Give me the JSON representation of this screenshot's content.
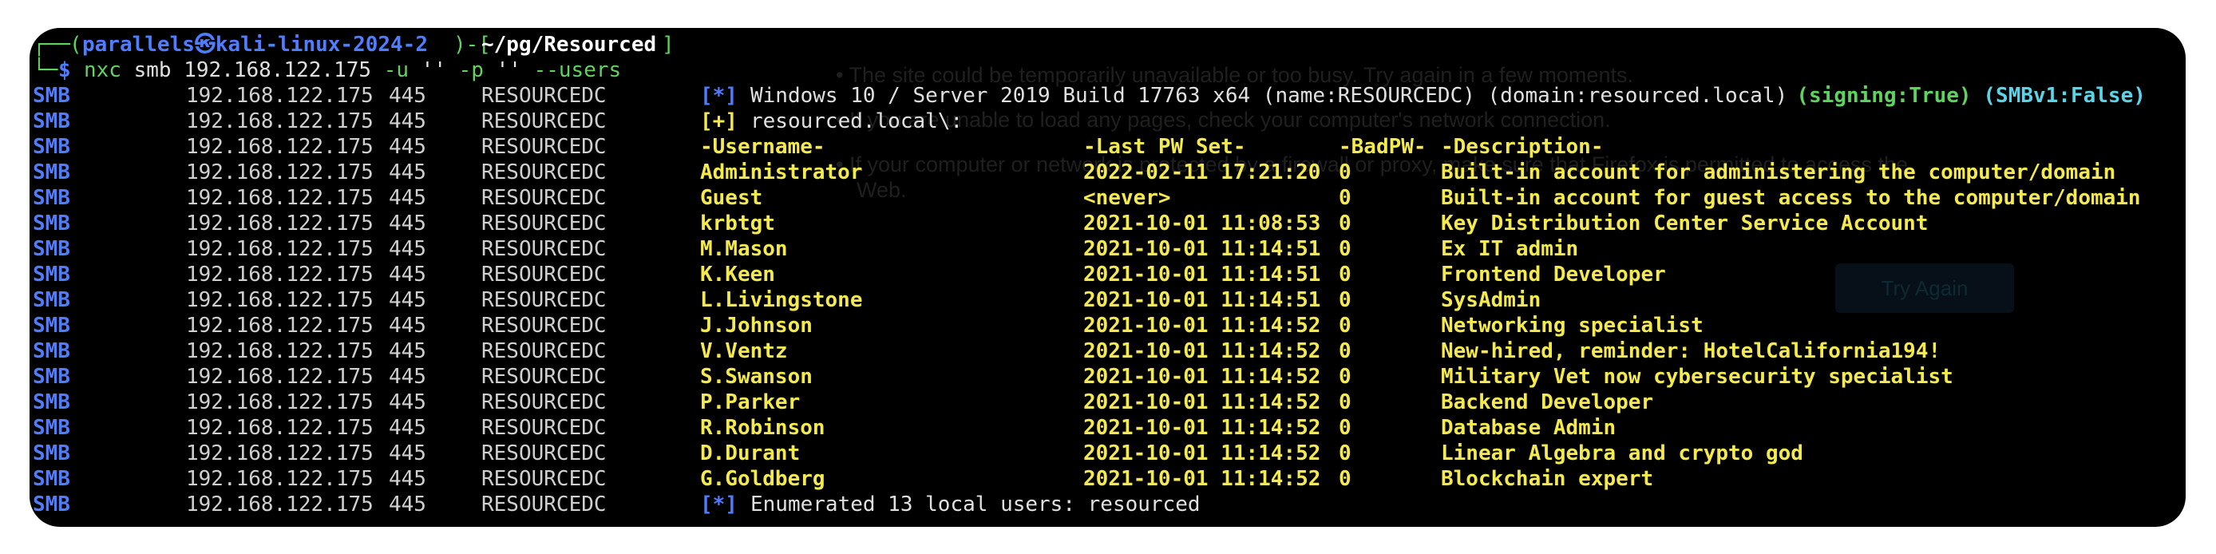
{
  "background_page": {
    "lines": [
      "The site could be temporarily unavailable or too busy. Try again in a few moments.",
      "If you are unable to load any pages, check your computer's network connection.",
      "If your computer or network is protected by a firewall or proxy, make sure that Firefox is permitted to access the",
      "Web."
    ],
    "try_again": "Try Again"
  },
  "prompt": {
    "corner_top": "┌──",
    "user_host": "parallels㉿kali-linux-2024-2",
    "path": "~/pg/Resourced",
    "corner_bottom": "└─",
    "dollar": "$",
    "command": "nxc smb 192.168.122.175 -u '' -p '' --users"
  },
  "rows": [
    {
      "proto": "SMB",
      "ip": "192.168.122.175",
      "port": "445",
      "host": "RESOURCEDC",
      "kind": "info",
      "tag": "[*]",
      "msg": "Windows 10 / Server 2019 Build 17763 x64 (name:RESOURCEDC) (domain:resourced.local)",
      "signing": "(signing:True)",
      "smbv1": "(SMBv1:False)"
    },
    {
      "proto": "SMB",
      "ip": "192.168.122.175",
      "port": "445",
      "host": "RESOURCEDC",
      "kind": "plus",
      "tag": "[+]",
      "msg": "resourced.local\\:"
    },
    {
      "proto": "SMB",
      "ip": "192.168.122.175",
      "port": "445",
      "host": "RESOURCEDC",
      "kind": "user",
      "user": "-Username-",
      "pwset": "-Last PW Set-",
      "bad": "-BadPW-",
      "desc": "-Description-"
    },
    {
      "proto": "SMB",
      "ip": "192.168.122.175",
      "port": "445",
      "host": "RESOURCEDC",
      "kind": "user",
      "user": "Administrator",
      "pwset": "2022-02-11 17:21:20",
      "bad": "0",
      "desc": "Built-in account for administering the computer/domain"
    },
    {
      "proto": "SMB",
      "ip": "192.168.122.175",
      "port": "445",
      "host": "RESOURCEDC",
      "kind": "user",
      "user": "Guest",
      "pwset": "<never>",
      "bad": "0",
      "desc": "Built-in account for guest access to the computer/domain"
    },
    {
      "proto": "SMB",
      "ip": "192.168.122.175",
      "port": "445",
      "host": "RESOURCEDC",
      "kind": "user",
      "user": "krbtgt",
      "pwset": "2021-10-01 11:08:53",
      "bad": "0",
      "desc": "Key Distribution Center Service Account"
    },
    {
      "proto": "SMB",
      "ip": "192.168.122.175",
      "port": "445",
      "host": "RESOURCEDC",
      "kind": "user",
      "user": "M.Mason",
      "pwset": "2021-10-01 11:14:51",
      "bad": "0",
      "desc": "Ex IT admin"
    },
    {
      "proto": "SMB",
      "ip": "192.168.122.175",
      "port": "445",
      "host": "RESOURCEDC",
      "kind": "user",
      "user": "K.Keen",
      "pwset": "2021-10-01 11:14:51",
      "bad": "0",
      "desc": "Frontend Developer"
    },
    {
      "proto": "SMB",
      "ip": "192.168.122.175",
      "port": "445",
      "host": "RESOURCEDC",
      "kind": "user",
      "user": "L.Livingstone",
      "pwset": "2021-10-01 11:14:51",
      "bad": "0",
      "desc": "SysAdmin"
    },
    {
      "proto": "SMB",
      "ip": "192.168.122.175",
      "port": "445",
      "host": "RESOURCEDC",
      "kind": "user",
      "user": "J.Johnson",
      "pwset": "2021-10-01 11:14:52",
      "bad": "0",
      "desc": "Networking specialist"
    },
    {
      "proto": "SMB",
      "ip": "192.168.122.175",
      "port": "445",
      "host": "RESOURCEDC",
      "kind": "user",
      "user": "V.Ventz",
      "pwset": "2021-10-01 11:14:52",
      "bad": "0",
      "desc": "New-hired, reminder: HotelCalifornia194!"
    },
    {
      "proto": "SMB",
      "ip": "192.168.122.175",
      "port": "445",
      "host": "RESOURCEDC",
      "kind": "user",
      "user": "S.Swanson",
      "pwset": "2021-10-01 11:14:52",
      "bad": "0",
      "desc": "Military Vet now cybersecurity specialist"
    },
    {
      "proto": "SMB",
      "ip": "192.168.122.175",
      "port": "445",
      "host": "RESOURCEDC",
      "kind": "user",
      "user": "P.Parker",
      "pwset": "2021-10-01 11:14:52",
      "bad": "0",
      "desc": "Backend Developer"
    },
    {
      "proto": "SMB",
      "ip": "192.168.122.175",
      "port": "445",
      "host": "RESOURCEDC",
      "kind": "user",
      "user": "R.Robinson",
      "pwset": "2021-10-01 11:14:52",
      "bad": "0",
      "desc": "Database Admin"
    },
    {
      "proto": "SMB",
      "ip": "192.168.122.175",
      "port": "445",
      "host": "RESOURCEDC",
      "kind": "user",
      "user": "D.Durant",
      "pwset": "2021-10-01 11:14:52",
      "bad": "0",
      "desc": "Linear Algebra and crypto god"
    },
    {
      "proto": "SMB",
      "ip": "192.168.122.175",
      "port": "445",
      "host": "RESOURCEDC",
      "kind": "user",
      "user": "G.Goldberg",
      "pwset": "2021-10-01 11:14:52",
      "bad": "0",
      "desc": "Blockchain expert"
    },
    {
      "proto": "SMB",
      "ip": "192.168.122.175",
      "port": "445",
      "host": "RESOURCEDC",
      "kind": "info",
      "tag": "[*]",
      "msg": "Enumerated 13 local users: resourced"
    }
  ],
  "colors": {
    "terminal_bg": "#000000",
    "smb_blue": "#4f7dff",
    "prompt_green": "#5fd35f",
    "user_yellow": "#f4e94e",
    "signing_green": "#5fd35f",
    "smbv1_cyan": "#5cd4e8"
  }
}
